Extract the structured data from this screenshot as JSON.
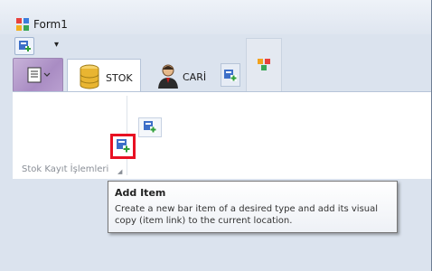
{
  "window": {
    "title": "Form1"
  },
  "quick_access": {
    "customize_arrow": "▾"
  },
  "tabs": [
    {
      "label": "STOK",
      "selected": true,
      "icon": "database-icon"
    },
    {
      "label": "CARİ",
      "selected": false,
      "icon": "user-icon"
    }
  ],
  "ribbon": {
    "group_label": "Stok Kayıt İşlemleri",
    "launcher": "◢"
  },
  "tooltip": {
    "title": "Add Item",
    "body": "Create a new bar item of a desired type and add its visual copy (item link) to the current location."
  },
  "colors": {
    "highlight": "#e81123",
    "selected_tab_bg": "#ffffff",
    "ribbon_border": "#b6c4d8"
  }
}
